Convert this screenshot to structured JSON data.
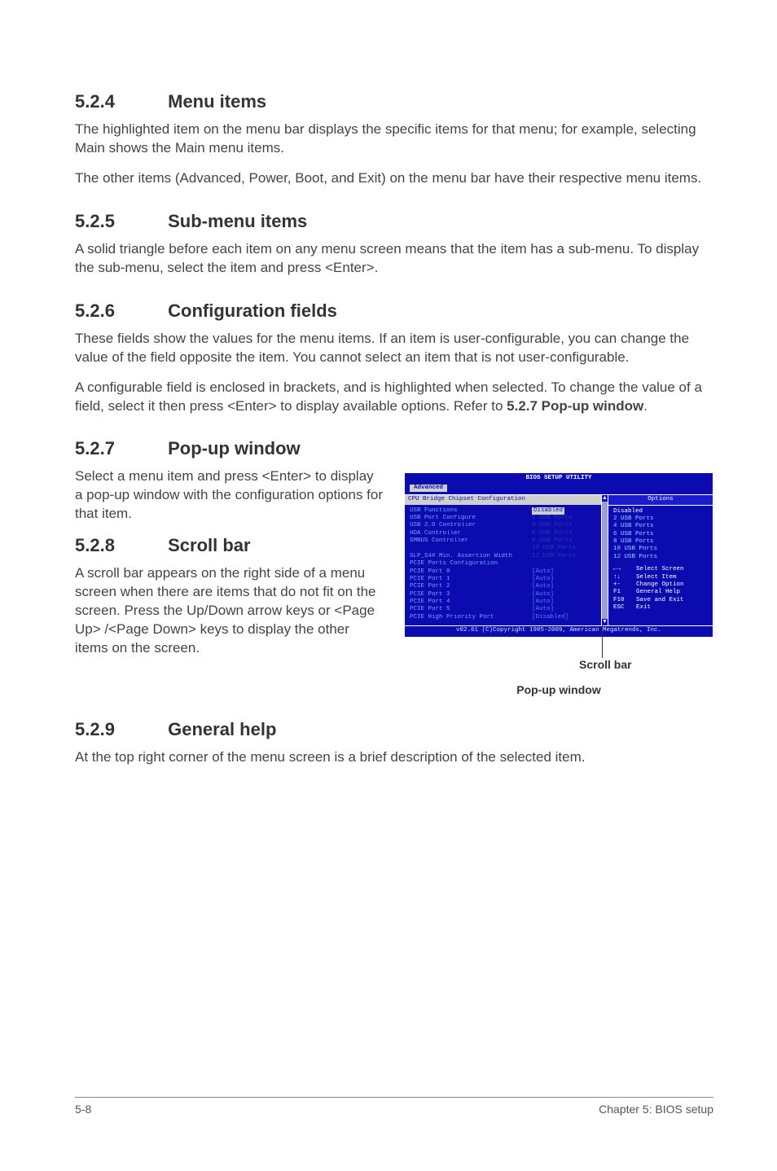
{
  "sections": {
    "s524": {
      "num": "5.2.4",
      "title": "Menu items",
      "p1": "The highlighted item on the menu bar displays the specific items for that menu; for example, selecting Main shows the Main menu items.",
      "p2": "The other items (Advanced, Power, Boot, and Exit) on the menu bar have their respective menu items."
    },
    "s525": {
      "num": "5.2.5",
      "title": "Sub-menu items",
      "p1": "A solid triangle before each item on any menu screen means that the item has a sub-menu. To display the sub-menu, select the item and press <Enter>."
    },
    "s526": {
      "num": "5.2.6",
      "title": "Configuration fields",
      "p1": "These fields show the values for the menu items. If an item is user-configurable, you can change the value of the field opposite the item. You cannot select an item that is not user-configurable.",
      "p2a": "A configurable field is enclosed in brackets, and is highlighted when selected. To change the value of a field, select it then press <Enter> to display available options. Refer to ",
      "p2b": "5.2.7 Pop-up window",
      "p2c": "."
    },
    "s527": {
      "num": "5.2.7",
      "title": "Pop-up window",
      "p1": "Select a menu item and press <Enter> to display a pop-up window with the configuration options for that item."
    },
    "s528": {
      "num": "5.2.8",
      "title": "Scroll bar",
      "p1": "A scroll bar appears on the right side of a menu screen when there are items that do not fit on the screen. Press the Up/Down arrow keys or <Page Up> /<Page Down> keys to display the other items on the screen."
    },
    "s529": {
      "num": "5.2.9",
      "title": "General help",
      "p1": "At the top right corner of the menu screen is a brief description of the selected item."
    }
  },
  "bios": {
    "title": "BIOS SETUP UTILITY",
    "tab": "Advanced",
    "left_title": "CPU Bridge Chipset Configuration",
    "rows": [
      {
        "label": "USB Functions",
        "value": "Disabled",
        "kind": "highlight"
      },
      {
        "label": "USB Port Configure",
        "value": "2 USB Ports",
        "kind": "dark"
      },
      {
        "label": "USB 2.0 Controller",
        "value": "4 USB Ports",
        "kind": "dark"
      },
      {
        "label": "HDA Controller",
        "value": "6 USB Ports",
        "kind": "dark"
      },
      {
        "label": "SMBUS Controller",
        "value": "8 USB Ports",
        "kind": "dark"
      },
      {
        "label": "",
        "value": "10 USB Ports",
        "kind": "dark"
      },
      {
        "label": "SLP_S4# Min. Assertion Width",
        "value": "12 USB Ports",
        "kind": "dark"
      },
      {
        "label": "",
        "value": "",
        "kind": ""
      },
      {
        "label": "PCIE Ports Configuration",
        "value": "",
        "kind": ""
      },
      {
        "label": " PCIE Port 0",
        "value": "[Auto]",
        "kind": ""
      },
      {
        "label": " PCIE Port 1",
        "value": "[Auto]",
        "kind": ""
      },
      {
        "label": " PCIE Port 2",
        "value": "[Auto]",
        "kind": ""
      },
      {
        "label": " PCIE Port 3",
        "value": "[Auto]",
        "kind": ""
      },
      {
        "label": " PCIE Port 4",
        "value": "[Auto]",
        "kind": ""
      },
      {
        "label": " PCIE Port 5",
        "value": "[Auto]",
        "kind": ""
      },
      {
        "label": " PCIE High Priority Port",
        "value": "[Disabled]",
        "kind": ""
      }
    ],
    "options_title": "Options",
    "options": [
      "Disabled",
      "2 USB Ports",
      "4 USB Ports",
      "6 USB Ports",
      "8 USB Ports",
      "10 USB Ports",
      "12 USB Ports"
    ],
    "keys": [
      {
        "k": "←→",
        "d": "Select Screen"
      },
      {
        "k": "↑↓",
        "d": "Select Item"
      },
      {
        "k": "+-",
        "d": "Change Option"
      },
      {
        "k": "F1",
        "d": "General Help"
      },
      {
        "k": "F10",
        "d": "Save and Exit"
      },
      {
        "k": "ESC",
        "d": "Exit"
      }
    ],
    "footer": "v02.61 (C)Copyright 1985-2009, American Megatrends, Inc.",
    "caption_scroll": "Scroll bar",
    "caption_popup": "Pop-up window"
  },
  "footer": {
    "left": "5-8",
    "right": "Chapter 5: BIOS setup"
  }
}
